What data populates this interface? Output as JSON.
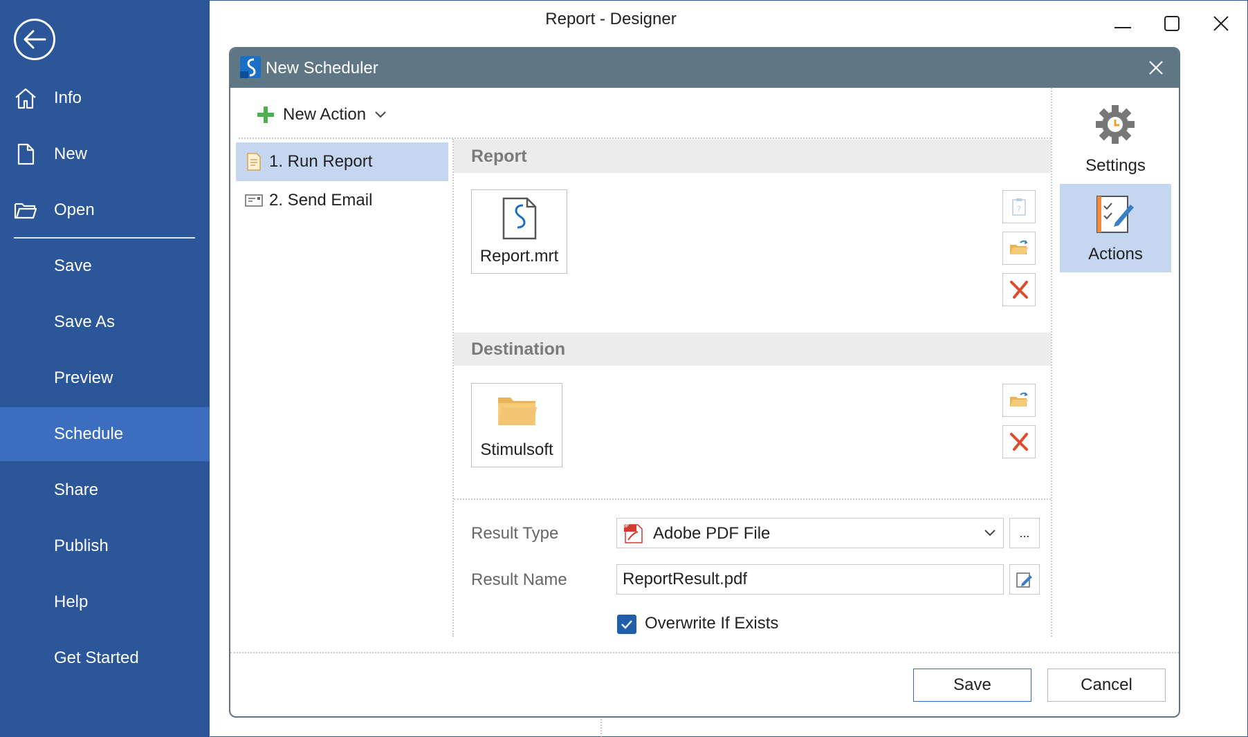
{
  "window": {
    "title": "Report - Designer"
  },
  "sidebar": {
    "items": [
      {
        "label": "Info",
        "icon": "home-icon"
      },
      {
        "label": "New",
        "icon": "file-icon"
      },
      {
        "label": "Open",
        "icon": "folder-icon"
      },
      {
        "label": "Save"
      },
      {
        "label": "Save As"
      },
      {
        "label": "Preview"
      },
      {
        "label": "Schedule",
        "active": true
      },
      {
        "label": "Share"
      },
      {
        "label": "Publish"
      },
      {
        "label": "Help"
      },
      {
        "label": "Get Started"
      }
    ]
  },
  "dialog": {
    "title": "New Scheduler",
    "new_action_label": "New Action",
    "actions": [
      {
        "label": "1. Run Report",
        "selected": true
      },
      {
        "label": "2. Send Email"
      }
    ],
    "report_section": {
      "title": "Report",
      "file_label": "Report.mrt"
    },
    "destination_section": {
      "title": "Destination",
      "folder_label": "Stimulsoft"
    },
    "result_type": {
      "label": "Result Type",
      "value": "Adobe PDF File",
      "more_label": "...",
      "pdf_badge": "PDF"
    },
    "result_name": {
      "label": "Result Name",
      "value": "ReportResult.pdf"
    },
    "overwrite": {
      "label": "Overwrite If Exists",
      "checked": true
    },
    "right_panel": [
      {
        "label": "Settings"
      },
      {
        "label": "Actions",
        "selected": true
      }
    ],
    "buttons": {
      "save": "Save",
      "cancel": "Cancel"
    }
  },
  "colors": {
    "sidebar_bg": "#2b569a",
    "sidebar_active": "#3c6ebf",
    "dialog_header": "#5f7684",
    "selection": "#c5d7f0",
    "checkbox": "#1e5fa8",
    "delete_red": "#e04a2f",
    "add_green": "#4caf50"
  }
}
